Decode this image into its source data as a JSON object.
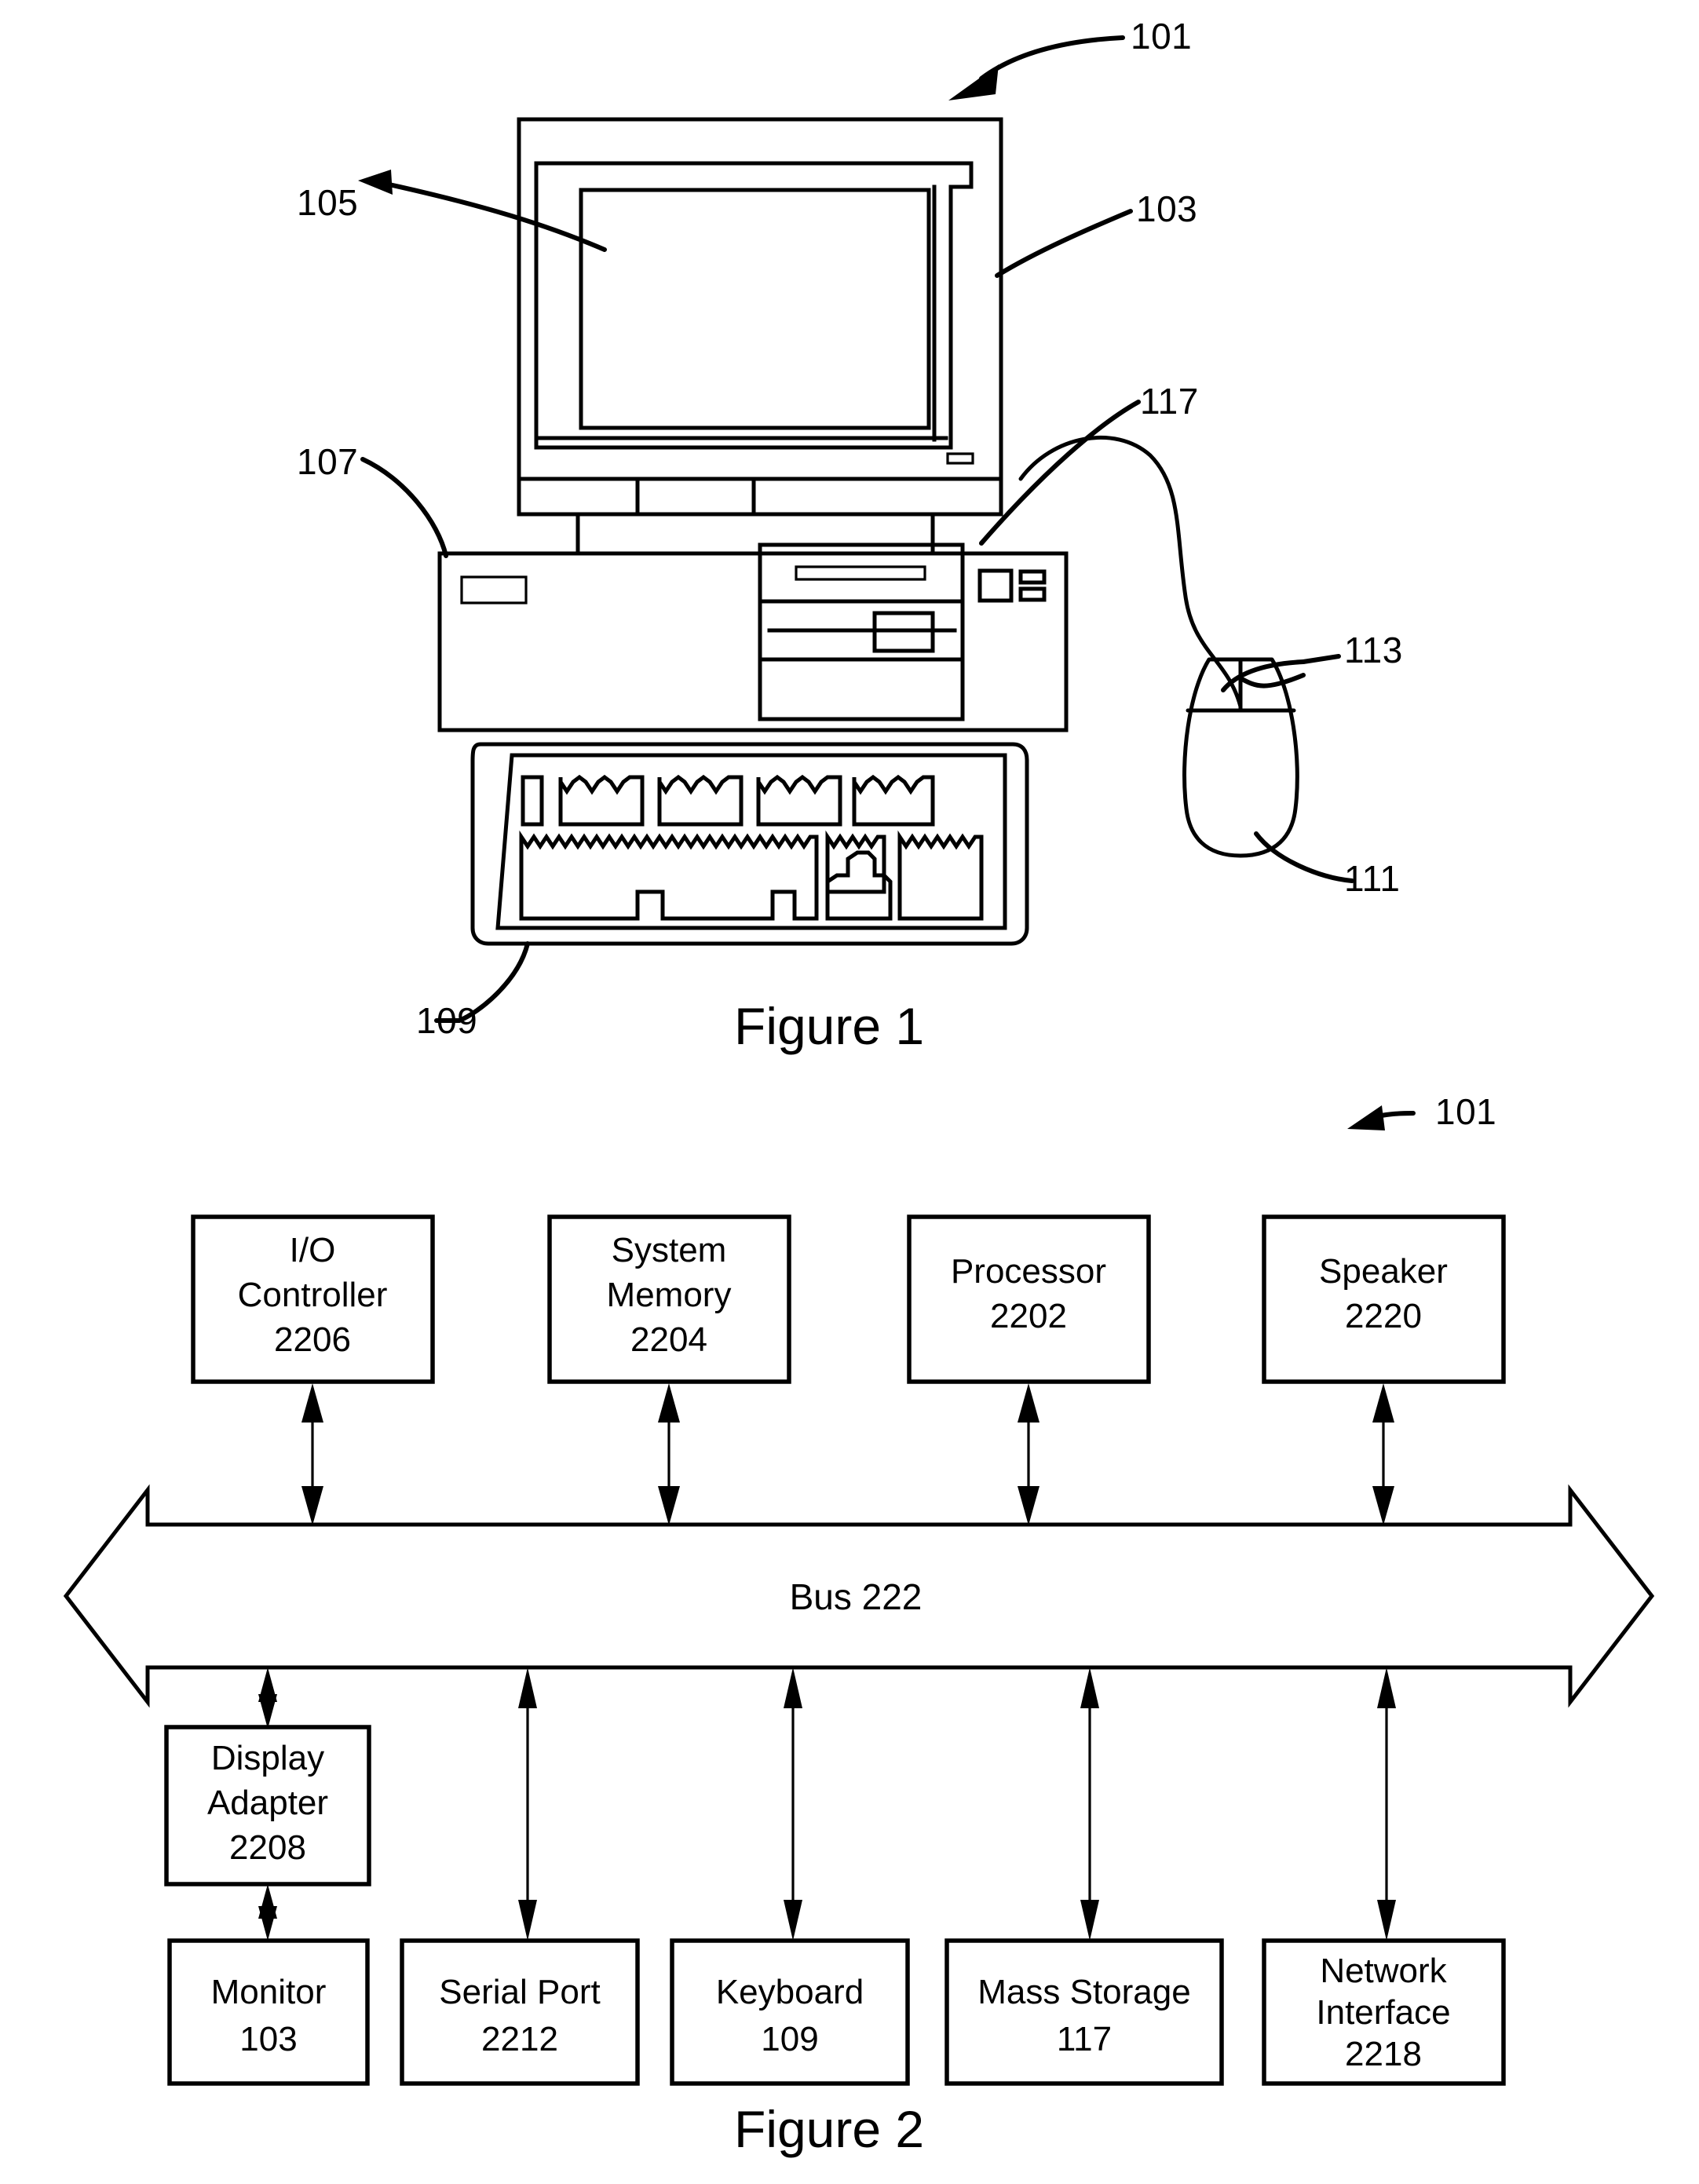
{
  "document": {
    "type": "patent-drawing-sheet",
    "figures": [
      {
        "id": "figure-1",
        "caption": "Figure 1",
        "description": "Desktop computer system with monitor, display screen, system unit, keyboard, mouse and mouse buttons",
        "reference_numerals": [
          {
            "number": "101",
            "refers_to": "computer system"
          },
          {
            "number": "103",
            "refers_to": "monitor"
          },
          {
            "number": "105",
            "refers_to": "display screen"
          },
          {
            "number": "107",
            "refers_to": "system unit / chassis"
          },
          {
            "number": "109",
            "refers_to": "keyboard"
          },
          {
            "number": "111",
            "refers_to": "mouse"
          },
          {
            "number": "113",
            "refers_to": "mouse buttons"
          },
          {
            "number": "117",
            "refers_to": "mass storage / drive bay"
          }
        ]
      },
      {
        "id": "figure-2",
        "caption": "Figure 2",
        "description": "Block diagram of the computer system architecture showing components attached to a common bus",
        "reference_numerals": [
          {
            "number": "101",
            "refers_to": "computer system"
          }
        ]
      }
    ]
  },
  "figure1": {
    "caption": "Figure 1",
    "labels": {
      "system": "101",
      "monitor": "103",
      "screen": "105",
      "system_unit": "107",
      "keyboard": "109",
      "mouse": "111",
      "mouse_buttons": "113",
      "mass_storage": "117"
    }
  },
  "figure2": {
    "caption": "Figure 2",
    "system_label": "101",
    "bus": {
      "label": "Bus 222",
      "name": "Bus",
      "numeral": "222"
    },
    "top_row": [
      {
        "name": "I/O Controller",
        "line1": "I/O",
        "line2": "Controller",
        "numeral": "2206"
      },
      {
        "name": "System Memory",
        "line1": "System",
        "line2": "Memory",
        "numeral": "2204"
      },
      {
        "name": "Processor",
        "line1": "Processor",
        "line2": "",
        "numeral": "2202"
      },
      {
        "name": "Speaker",
        "line1": "Speaker",
        "line2": "",
        "numeral": "2220"
      }
    ],
    "adapter": {
      "name": "Display Adapter",
      "line1": "Display",
      "line2": "Adapter",
      "numeral": "2208"
    },
    "bottom_row": [
      {
        "name": "Monitor",
        "line1": "Monitor",
        "line2": "",
        "numeral": "103"
      },
      {
        "name": "Serial Port",
        "line1": "Serial Port",
        "line2": "",
        "numeral": "2212"
      },
      {
        "name": "Keyboard",
        "line1": "Keyboard",
        "line2": "",
        "numeral": "109"
      },
      {
        "name": "Mass Storage",
        "line1": "Mass Storage",
        "line2": "",
        "numeral": "117"
      },
      {
        "name": "Network Interface",
        "line1": "Network",
        "line2": "Interface",
        "numeral": "2218"
      }
    ]
  },
  "colors": {
    "ink": "#000000",
    "paper": "#ffffff"
  }
}
